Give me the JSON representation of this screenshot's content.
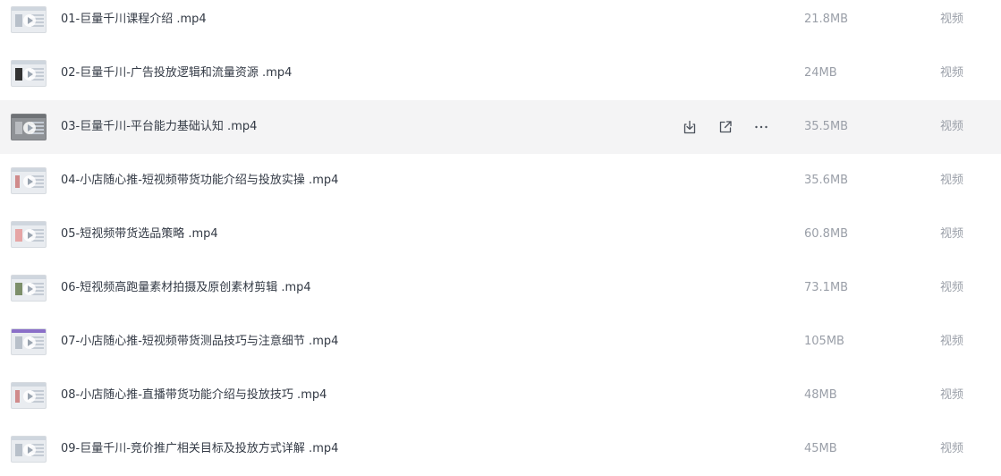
{
  "files": [
    {
      "name": "01-巨量千川课程介绍 .mp4",
      "size": "21.8MB",
      "type": "视频",
      "thumb": "doc"
    },
    {
      "name": "02-巨量千川-广告投放逻辑和流量资源 .mp4",
      "size": "24MB",
      "type": "视频",
      "thumb": "photo"
    },
    {
      "name": "03-巨量千川-平台能力基础认知 .mp4",
      "size": "35.5MB",
      "type": "视频",
      "thumb": "dark"
    },
    {
      "name": "04-小店随心推-短视频带货功能介绍与投放实操 .mp4",
      "size": "35.6MB",
      "type": "视频",
      "thumb": "red"
    },
    {
      "name": "05-短视频带货选品策略 .mp4",
      "size": "60.8MB",
      "type": "视频",
      "thumb": "pink"
    },
    {
      "name": "06-短视频高跑量素材拍摄及原创素材剪辑 .mp4",
      "size": "73.1MB",
      "type": "视频",
      "thumb": "green"
    },
    {
      "name": "07-小店随心推-短视频带货测品技巧与注意细节 .mp4",
      "size": "105MB",
      "type": "视频",
      "thumb": "purple"
    },
    {
      "name": "08-小店随心推-直播带货功能介绍与投放技巧 .mp4",
      "size": "48MB",
      "type": "视频",
      "thumb": "red"
    },
    {
      "name": "09-巨量千川-竞价推广相关目标及投放方式详解 .mp4",
      "size": "45MB",
      "type": "视频",
      "thumb": "doc"
    }
  ],
  "hovered_index": 2,
  "row_actions": {
    "download_icon": "download-icon",
    "share_icon": "external-link-icon",
    "more_icon": "more-horizontal-icon"
  }
}
